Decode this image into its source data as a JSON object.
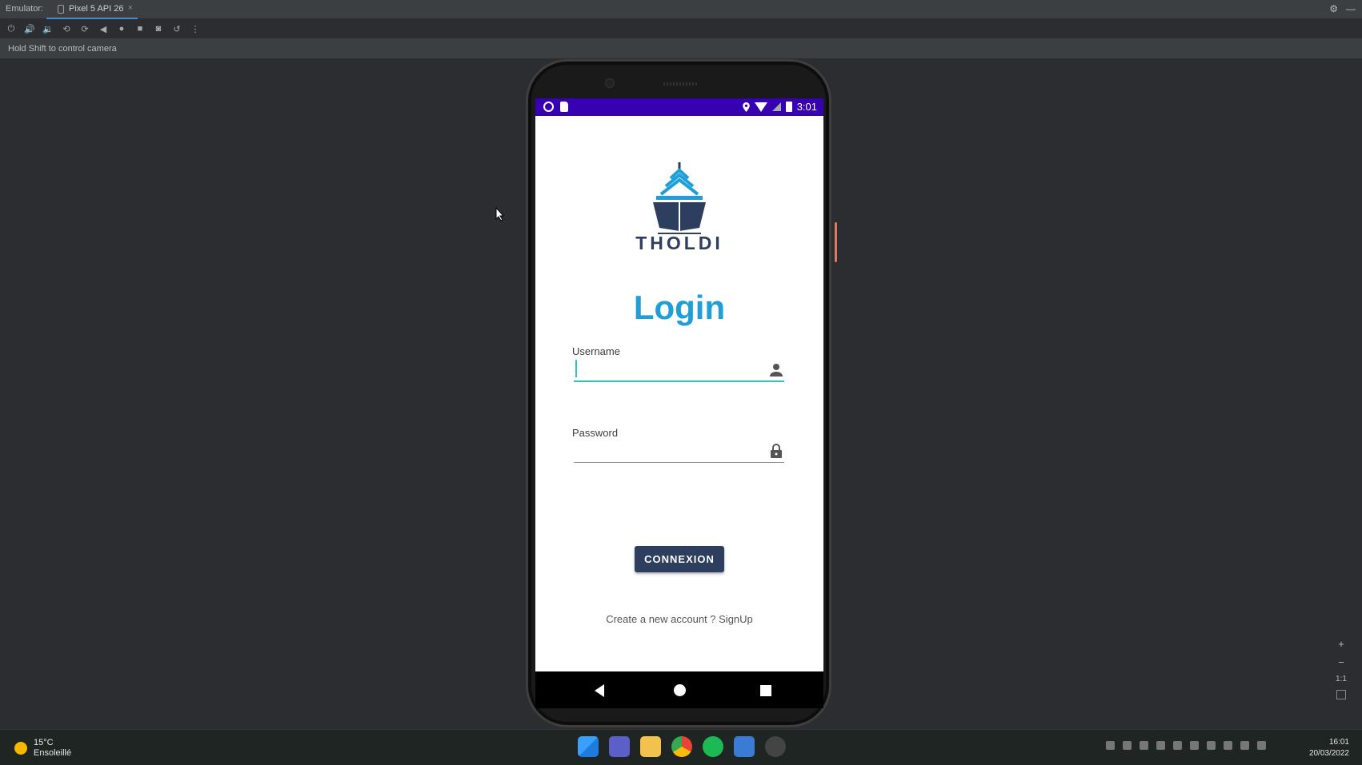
{
  "ide": {
    "tool_window_label": "Emulator:",
    "device_tab": "Pixel 5 API 26",
    "tab_close": "×",
    "hint": "Hold Shift to control camera",
    "zoom_in": "+",
    "zoom_out": "−",
    "zoom_actual": "1:1"
  },
  "phone": {
    "status_time": "3:01",
    "brand_text": "THOLDI",
    "title": "Login",
    "username_label": "Username",
    "username_value": "",
    "password_label": "Password",
    "password_value": "",
    "connexion_button": "CONNEXION",
    "signup_text": "Create a new account ? SignUp",
    "colors": {
      "statusbar": "#3700b3",
      "title": "#1e9fd8",
      "brand": "#2d3e5f",
      "button": "#2d3e5f",
      "focus_underline": "#2ec4b6",
      "logo_waves": "#1e9fd8",
      "logo_hull": "#2d3e5f"
    }
  },
  "taskbar": {
    "weather_temp": "15°C",
    "weather_desc": "Ensoleillé",
    "clock_time": "16:01",
    "clock_date": "20/03/2022"
  }
}
